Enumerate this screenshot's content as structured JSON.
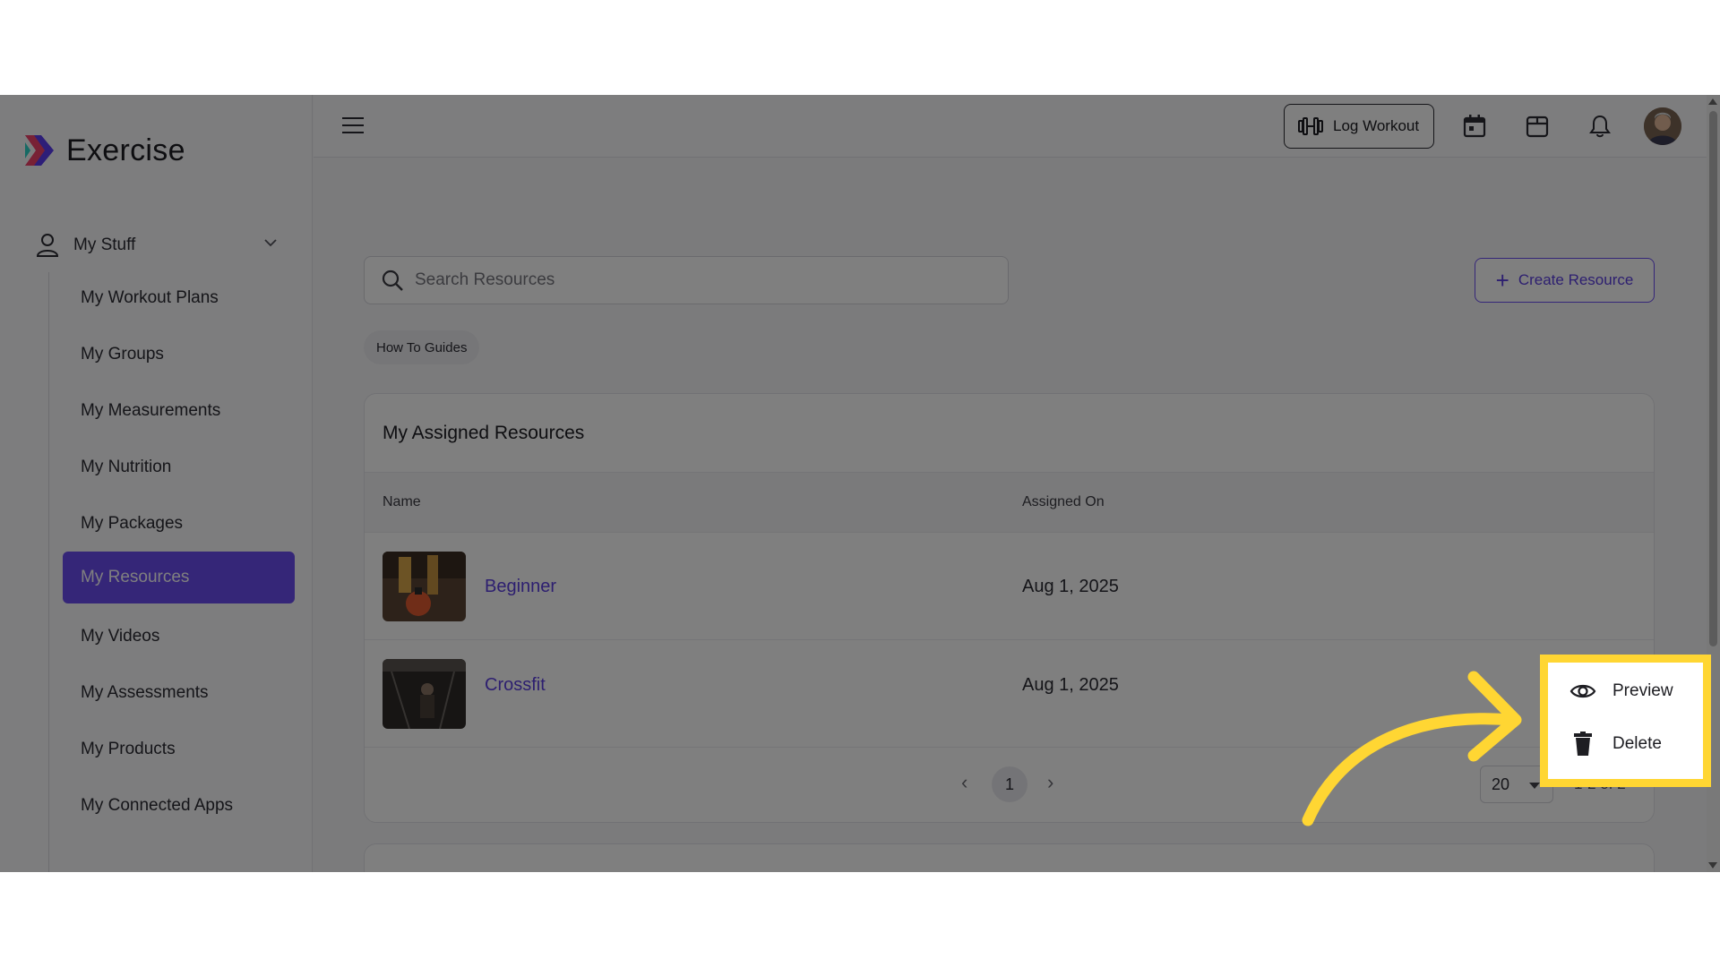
{
  "app": {
    "name": "Exercise"
  },
  "sidebar": {
    "group": {
      "label": "My Stuff"
    },
    "items": [
      {
        "label": "My Workout Plans"
      },
      {
        "label": "My Groups"
      },
      {
        "label": "My Measurements"
      },
      {
        "label": "My Nutrition"
      },
      {
        "label": "My Packages"
      },
      {
        "label": "My Resources",
        "active": true
      },
      {
        "label": "My Videos"
      },
      {
        "label": "My Assessments"
      },
      {
        "label": "My Products"
      },
      {
        "label": "My Connected Apps"
      }
    ]
  },
  "topbar": {
    "log_workout_label": "Log Workout",
    "icons": [
      "hamburger-icon",
      "dumbbell-icon",
      "calendar-icon",
      "box-icon",
      "bell-icon",
      "avatar"
    ]
  },
  "search": {
    "placeholder": "Search Resources"
  },
  "create_button": {
    "label": "Create Resource"
  },
  "filter_chip": {
    "label": "How To Guides"
  },
  "assigned": {
    "title": "My Assigned Resources",
    "columns": {
      "name": "Name",
      "assigned_on": "Assigned On"
    },
    "rows": [
      {
        "name": "Beginner",
        "assigned_on": "Aug 1, 2025"
      },
      {
        "name": "Crossfit",
        "assigned_on": "Aug 1, 2025"
      }
    ],
    "pagination": {
      "current_page": "1",
      "per_page": "20",
      "range": "1-2 of 2"
    }
  },
  "context_menu": {
    "items": [
      {
        "label": "Preview",
        "icon": "eye-icon"
      },
      {
        "label": "Delete",
        "icon": "trash-icon"
      }
    ]
  },
  "colors": {
    "accent": "#6b4cf0",
    "link": "#5b3ee0",
    "highlight": "#ffd633"
  }
}
